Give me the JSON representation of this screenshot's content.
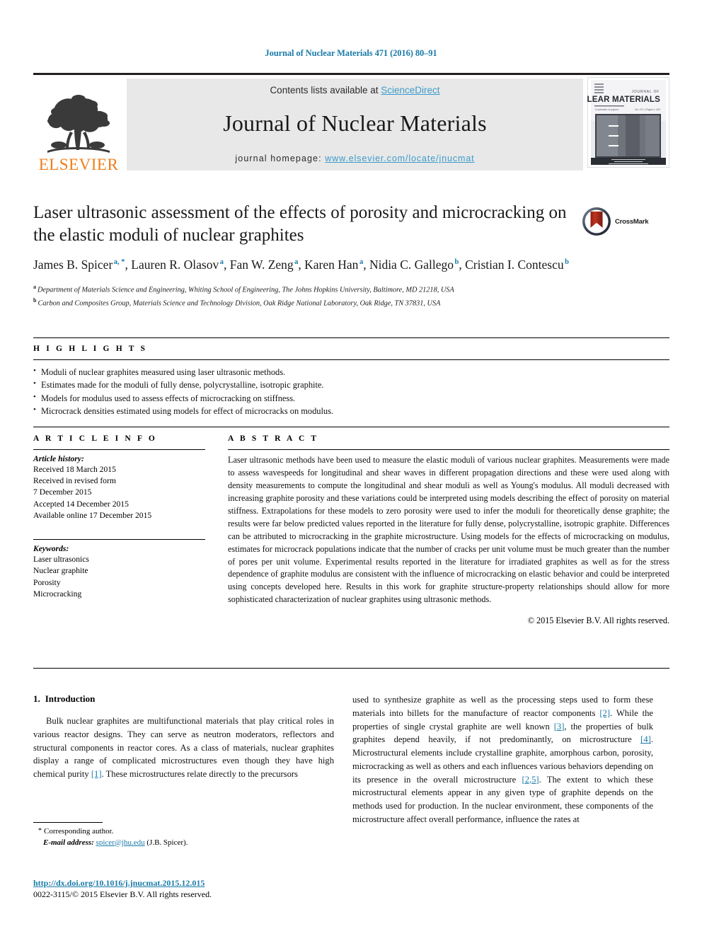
{
  "running_head": "Journal of Nuclear Materials 471 (2016) 80–91",
  "masthead": {
    "publisher_name": "ELSEVIER",
    "contents_prefix": "Contents lists available at ",
    "contents_link": "ScienceDirect",
    "journal_title": "Journal of Nuclear Materials",
    "homepage_prefix": "journal homepage: ",
    "homepage_url": "www.elsevier.com/locate/jnucmat",
    "cover": {
      "journal_label_small": "JOURNAL OF",
      "journal_label_main": "NUCLEAR MATERIALS"
    },
    "colors": {
      "elsevier_orange": "#ef7d1a",
      "link_blue": "#3c9bc9",
      "band_gray": "#e8e8e8"
    }
  },
  "article": {
    "title": "Laser ultrasonic assessment of the effects of porosity and microcracking on the elastic moduli of nuclear graphites",
    "authors": [
      {
        "name": "James B. Spicer",
        "marks": "a, *",
        "sep": ", "
      },
      {
        "name": "Lauren R. Olasov",
        "marks": "a",
        "sep": ", "
      },
      {
        "name": "Fan W. Zeng",
        "marks": "a",
        "sep": ", "
      },
      {
        "name": "Karen Han",
        "marks": "a",
        "sep": ", "
      },
      {
        "name": "Nidia C. Gallego",
        "marks": "b",
        "sep": ", "
      },
      {
        "name": "Cristian I. Contescu",
        "marks": "b",
        "sep": ""
      }
    ],
    "affiliations": [
      {
        "mark": "a",
        "text": "Department of Materials Science and Engineering, Whiting School of Engineering, The Johns Hopkins University, Baltimore, MD 21218, USA"
      },
      {
        "mark": "b",
        "text": "Carbon and Composites Group, Materials Science and Technology Division, Oak Ridge National Laboratory, Oak Ridge, TN 37831, USA"
      }
    ],
    "crossmark_label": "CrossMark"
  },
  "highlights": {
    "heading": "H I G H L I G H T S",
    "items": [
      "Moduli of nuclear graphites measured using laser ultrasonic methods.",
      "Estimates made for the moduli of fully dense, polycrystalline, isotropic graphite.",
      "Models for modulus used to assess effects of microcracking on stiffness.",
      "Microcrack densities estimated using models for effect of microcracks on modulus."
    ]
  },
  "article_info": {
    "heading": "A R T I C L E  I N F O",
    "history_label": "Article history:",
    "history_lines": [
      "Received 18 March 2015",
      "Received in revised form",
      "7 December 2015",
      "Accepted 14 December 2015",
      "Available online 17 December 2015"
    ],
    "keywords_label": "Keywords:",
    "keywords": [
      "Laser ultrasonics",
      "Nuclear graphite",
      "Porosity",
      "Microcracking"
    ]
  },
  "abstract": {
    "heading": "A B S T R A C T",
    "text": "Laser ultrasonic methods have been used to measure the elastic moduli of various nuclear graphites. Measurements were made to assess wavespeeds for longitudinal and shear waves in different propagation directions and these were used along with density measurements to compute the longitudinal and shear moduli as well as Young's modulus. All moduli decreased with increasing graphite porosity and these variations could be interpreted using models describing the effect of porosity on material stiffness. Extrapolations for these models to zero porosity were used to infer the moduli for theoretically dense graphite; the results were far below predicted values reported in the literature for fully dense, polycrystalline, isotropic graphite. Differences can be attributed to microcracking in the graphite microstructure. Using models for the effects of microcracking on modulus, estimates for microcrack populations indicate that the number of cracks per unit volume must be much greater than the number of pores per unit volume. Experimental results reported in the literature for irradiated graphites as well as for the stress dependence of graphite modulus are consistent with the influence of microcracking on elastic behavior and could be interpreted using concepts developed here. Results in this work for graphite structure-property relationships should allow for more sophisticated characterization of nuclear graphites using ultrasonic methods.",
    "copyright": "© 2015 Elsevier B.V. All rights reserved."
  },
  "body": {
    "section_number": "1.",
    "section_title": "Introduction",
    "left_paragraph_parts": {
      "p1": "Bulk nuclear graphites are multifunctional materials that play critical roles in various reactor designs. They can serve as neutron moderators, reflectors and structural components in reactor cores. As a class of materials, nuclear graphites display a range of complicated microstructures even though they have high chemical purity ",
      "ref1": "[1]",
      "p2": ". These microstructures relate directly to the precursors"
    },
    "right_paragraph_parts": {
      "p1": "used to synthesize graphite as well as the processing steps used to form these materials into billets for the manufacture of reactor components ",
      "ref2": "[2]",
      "p2": ". While the properties of single crystal graphite are well known ",
      "ref3": "[3]",
      "p3": ", the properties of bulk graphites depend heavily, if not predominantly, on microstructure ",
      "ref4": "[4]",
      "p4": ". Microstructural elements include crystalline graphite, amorphous carbon, porosity, microcracking as well as others and each influences various behaviors depending on its presence in the overall microstructure ",
      "ref5": "[2,5]",
      "p5": ". The extent to which these microstructural elements appear in any given type of graphite depends on the methods used for production. In the nuclear environment, these components of the microstructure affect overall performance, influence the rates at"
    }
  },
  "footnote": {
    "corresponding_marker": "*",
    "corresponding_text": "Corresponding author.",
    "email_label": "E-mail address:",
    "email": "spicer@jhu.edu",
    "email_owner": "(J.B. Spicer)."
  },
  "imprint": {
    "doi": "http://dx.doi.org/10.1016/j.jnucmat.2015.12.015",
    "issn_line": "0022-3115/© 2015 Elsevier B.V. All rights reserved."
  }
}
